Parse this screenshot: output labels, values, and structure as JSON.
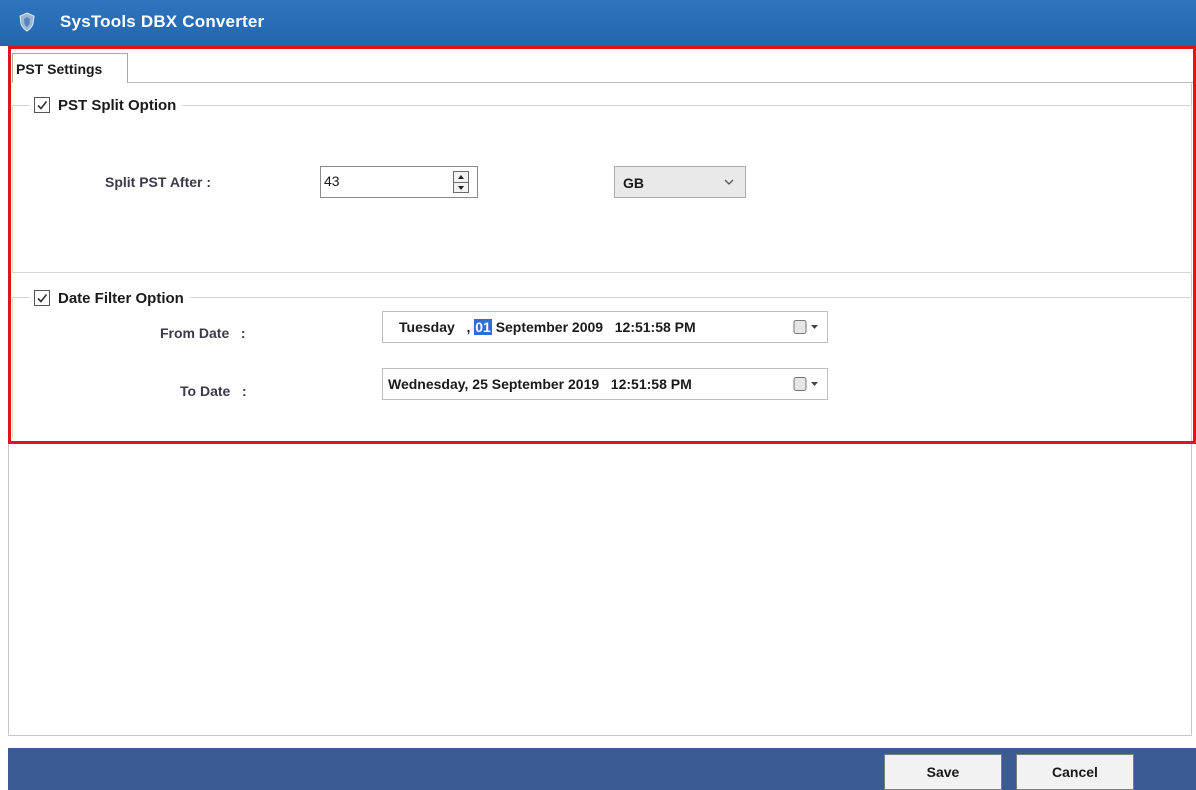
{
  "window": {
    "title": "SysTools  DBX Converter",
    "icon": "app-shield-icon"
  },
  "tabs": [
    {
      "label": "PST Settings",
      "active": true
    }
  ],
  "pst_split": {
    "label": "PST Split Option",
    "checked": true,
    "split_label": "Split PST After :",
    "value": "43",
    "unit": "GB"
  },
  "date_filter": {
    "label": "Date Filter Option",
    "checked": true,
    "from_label": "From Date   :",
    "from_weekday": "Tuesday",
    "from_sep": ",",
    "from_day": "01",
    "from_rest": "September 2009   12:51:58 PM",
    "to_label": "To Date   :",
    "to_value": "Wednesday, 25 September 2019   12:51:58 PM"
  },
  "footer": {
    "save_label": "Save",
    "cancel_label": "Cancel"
  },
  "colors": {
    "titlebar": "#2266ae",
    "highlight_frame": "#e0141c",
    "footer": "#3a5b93",
    "selection": "#2b6fd0"
  }
}
